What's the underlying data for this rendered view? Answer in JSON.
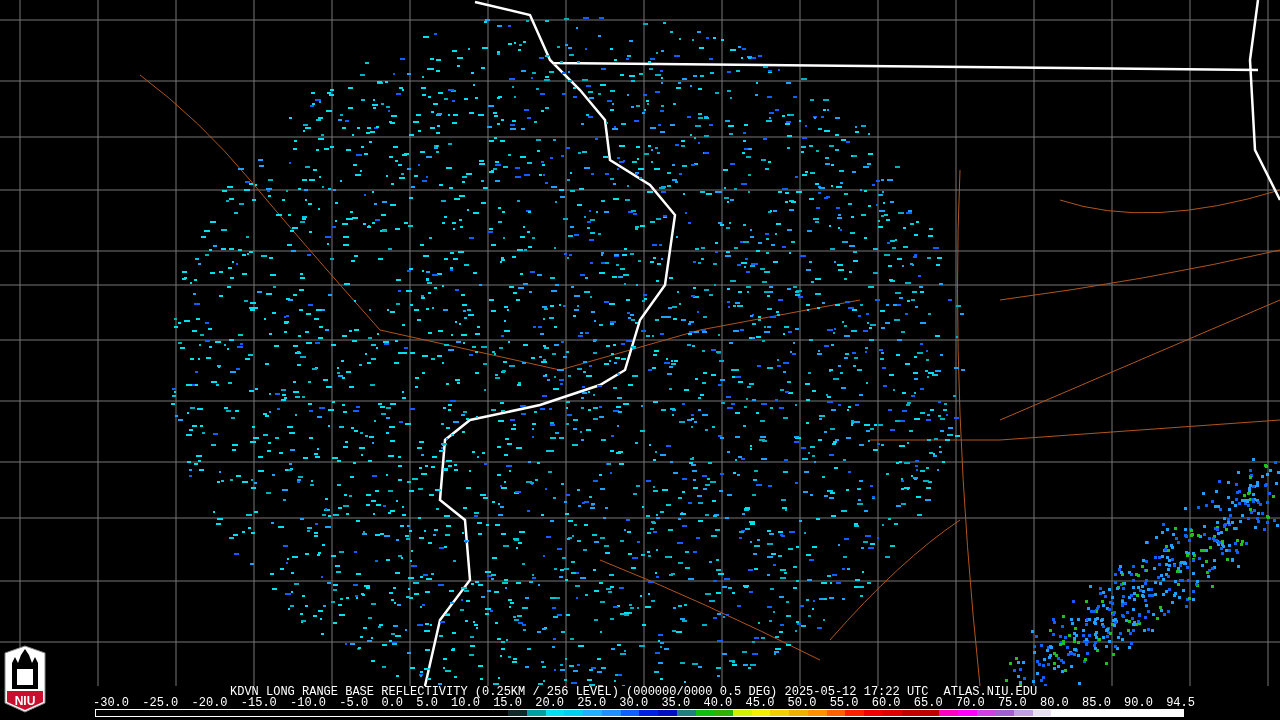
{
  "logo": {
    "text": "NIU"
  },
  "product_title": "KDVN LONG RANGE BASE REFLECTIVITY (0.25KM / 256 LEVEL) (000000/0000 0.5 DEG) 2025-05-12 17:22 UTC",
  "site": "ATLAS.NIU.EDU",
  "scale_labels": [
    "-30.0",
    "-25.0",
    "-20.0",
    "-15.0",
    "-10.0",
    "-5.0",
    "0.0",
    "5.0",
    "10.0",
    "15.0",
    "20.0",
    "25.0",
    "30.0",
    "35.0",
    "40.0",
    "45.0",
    "50.0",
    "55.0",
    "60.0",
    "65.0",
    "70.0",
    "75.0",
    "80.0",
    "85.0",
    "90.0",
    "94.5"
  ]
}
